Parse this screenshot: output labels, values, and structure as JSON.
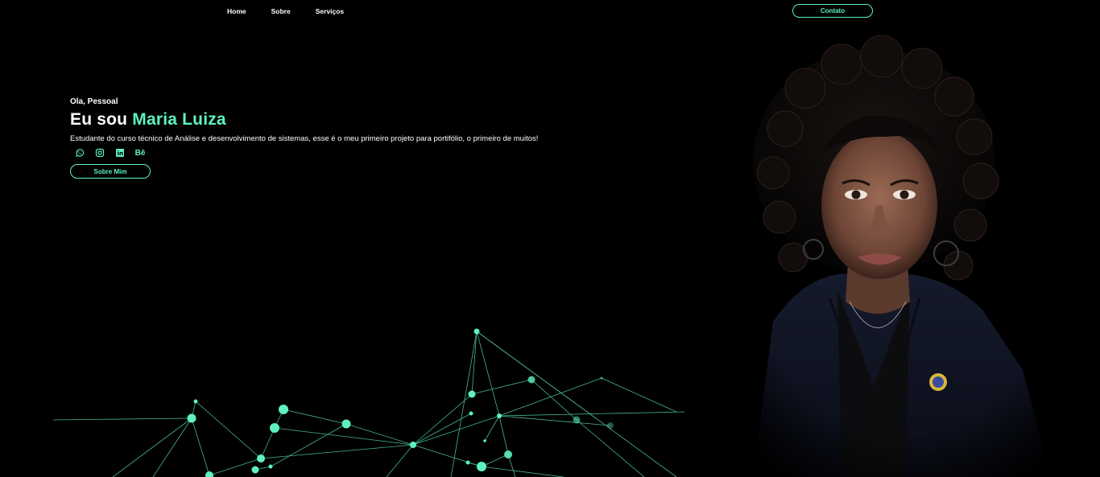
{
  "nav": {
    "links": [
      "Home",
      "Sobre",
      "Serviços"
    ],
    "contact_label": "Contato"
  },
  "hero": {
    "greeting": "Ola, Pessoal",
    "headline_prefix": "Eu sou ",
    "headline_name": "Maria Luiza",
    "description": "Estudante do curso técnico de Análise e desenvolvimento de sistemas, esse é o meu primeiro projeto para portifólio, o primeiro de muitos!",
    "socials": [
      "whatsapp-icon",
      "instagram-icon",
      "linkedin-icon",
      "behance-icon"
    ],
    "behance_text": "Bē",
    "about_button": "Sobre Mim"
  },
  "colors": {
    "accent": "#5ef2c0",
    "background": "#000000",
    "text": "#ffffff"
  }
}
